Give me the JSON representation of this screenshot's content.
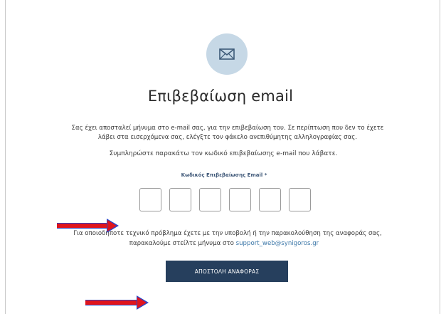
{
  "page": {
    "title": "Επιβεβαίωση email",
    "message_line1": "Σας έχει αποσταλεί μήνυμα στο e-mail σας, για την επιβεβαίωση του. Σε περίπτωση που δεν το έχετε",
    "message_line2": "λάβει στα εισερχόμενα σας, ελέγξτε τον φάκελο ανεπιθύμητης αλληλογραφίας σας.",
    "instruction": "Συμπληρώστε παρακάτω τον κωδικό επιβεβαίωσης e-mail που λάβατε.",
    "code_label": "Κωδικός Επιβεβαίωσης Email *",
    "code_digits": [
      "",
      "",
      "",
      "",
      "",
      ""
    ],
    "support_line1": "Για οποιοδήποτε τεχνικό πρόβλημα έχετε με την υποβολή ή την παρακολούθηση της αναφοράς σας,",
    "support_line2_prefix": "παρακαλούμε στείλτε μήνυμα στο ",
    "support_email": "support_web@synigoros.gr",
    "submit_label": "ΑΠΟΣΤΟΛΗ ΑΝΑΦΟΡΑΣ"
  },
  "icons": {
    "mail": "envelope-icon",
    "annotation": "red-arrow"
  },
  "colors": {
    "accent": "#263f5d",
    "icon_bg": "#c6d8e6",
    "link": "#3c77a8",
    "arrow_red": "#e0141c",
    "arrow_blue": "#2a45c8"
  }
}
